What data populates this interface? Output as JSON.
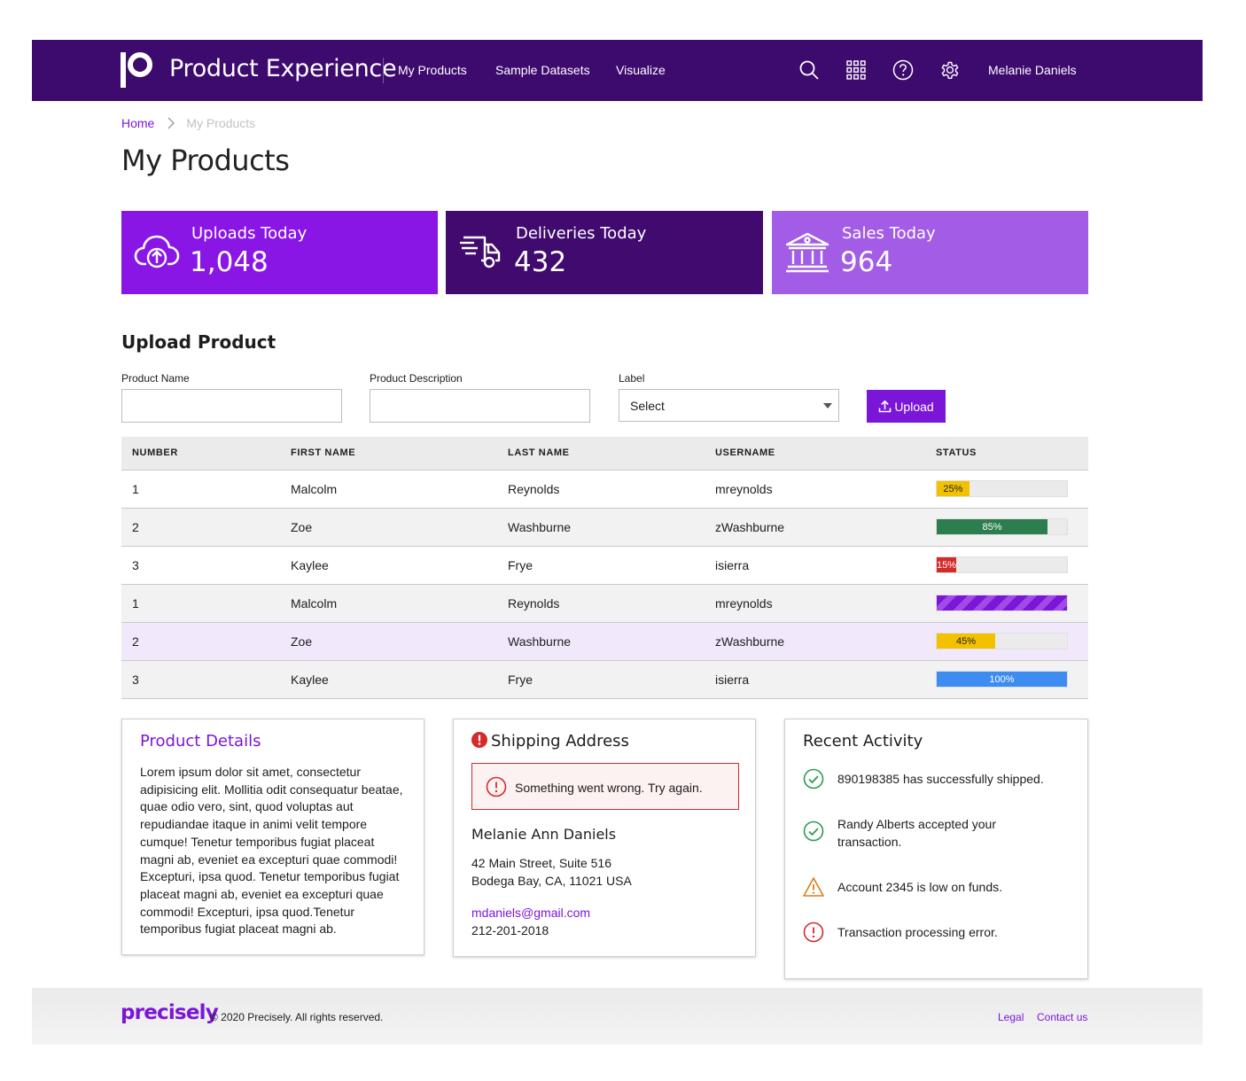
{
  "header": {
    "app_title": "Product Experience",
    "nav": [
      "My Products",
      "Sample Datasets",
      "Visualize"
    ],
    "user_name": "Melanie Daniels",
    "background_color": "#3d0a6e",
    "icons": [
      "search-icon",
      "apps-grid-icon",
      "help-icon",
      "settings-gear-icon"
    ]
  },
  "breadcrumb": {
    "home": "Home",
    "current": "My Products"
  },
  "page_title": "My Products",
  "stats": [
    {
      "label": "Uploads Today",
      "value": "1,048",
      "icon": "cloud-upload-icon",
      "color": "#8a16e6"
    },
    {
      "label": "Deliveries Today",
      "value": "432",
      "icon": "delivery-truck-icon",
      "color": "#400a6f"
    },
    {
      "label": "Sales Today",
      "value": "964",
      "icon": "bank-icon",
      "color": "#a25ce6"
    }
  ],
  "upload": {
    "title": "Upload Product",
    "product_name_label": "Product Name",
    "product_name_value": "",
    "product_description_label": "Product Description",
    "product_description_value": "",
    "label_label": "Label",
    "label_selected": "Select",
    "button_label": "Upload"
  },
  "table": {
    "columns": [
      "NUMBER",
      "FIRST NAME",
      "LAST NAME",
      "USERNAME",
      "STATUS"
    ],
    "rows": [
      {
        "number": "1",
        "first": "Malcolm",
        "last": "Reynolds",
        "username": "mreynolds",
        "progress": 25,
        "progress_label": "25%",
        "status": "warning"
      },
      {
        "number": "2",
        "first": "Zoe",
        "last": "Washburne",
        "username": "zWashburne",
        "progress": 85,
        "progress_label": "85%",
        "status": "success"
      },
      {
        "number": "3",
        "first": "Kaylee",
        "last": "Frye",
        "username": "isierra",
        "progress": 15,
        "progress_label": "15%",
        "status": "error"
      },
      {
        "number": "1",
        "first": "Malcolm",
        "last": "Reynolds",
        "username": "mreynolds",
        "progress": 100,
        "progress_label": "",
        "status": "indeterminate"
      },
      {
        "number": "2",
        "first": "Zoe",
        "last": "Washburne",
        "username": "zWashburne",
        "progress": 45,
        "progress_label": "45%",
        "status": "warning"
      },
      {
        "number": "3",
        "first": "Kaylee",
        "last": "Frye",
        "username": "isierra",
        "progress": 100,
        "progress_label": "100%",
        "status": "info"
      }
    ]
  },
  "product_details": {
    "title": "Product Details",
    "body": "Lorem ipsum dolor sit amet, consectetur adipisicing elit. Mollitia odit consequatur beatae, quae odio vero, sint, quod voluptas aut repudiandae itaque in animi velit tempore cumque! Tenetur temporibus fugiat placeat magni ab, eveniet ea excepturi quae commodi! Excepturi, ipsa quod. Tenetur temporibus fugiat placeat magni ab, eveniet ea excepturi quae commodi! Excepturi, ipsa quod.Tenetur temporibus fugiat placeat magni ab."
  },
  "shipping": {
    "title": "Shipping Address",
    "error_message": "Something went wrong. Try again.",
    "name": "Melanie Ann Daniels",
    "address_line1": "42 Main Street, Suite 516",
    "address_line2": "Bodega Bay, CA, 11021 USA",
    "email": "mdaniels@gmail.com",
    "phone": "212-201-2018"
  },
  "activity": {
    "title": "Recent Activity",
    "items": [
      {
        "text": "890198385 has successfully shipped.",
        "icon": "success-check-icon"
      },
      {
        "text": "Randy Alberts accepted your transaction.",
        "icon": "success-check-icon"
      },
      {
        "text": "Account 2345 is low on funds.",
        "icon": "warning-triangle-icon"
      },
      {
        "text": "Transaction processing error.",
        "icon": "error-circle-icon"
      }
    ]
  },
  "footer": {
    "logo": "precisely",
    "copyright": "© 2020 Precisely. All rights reserved.",
    "links": [
      "Legal",
      "Contact us"
    ]
  }
}
